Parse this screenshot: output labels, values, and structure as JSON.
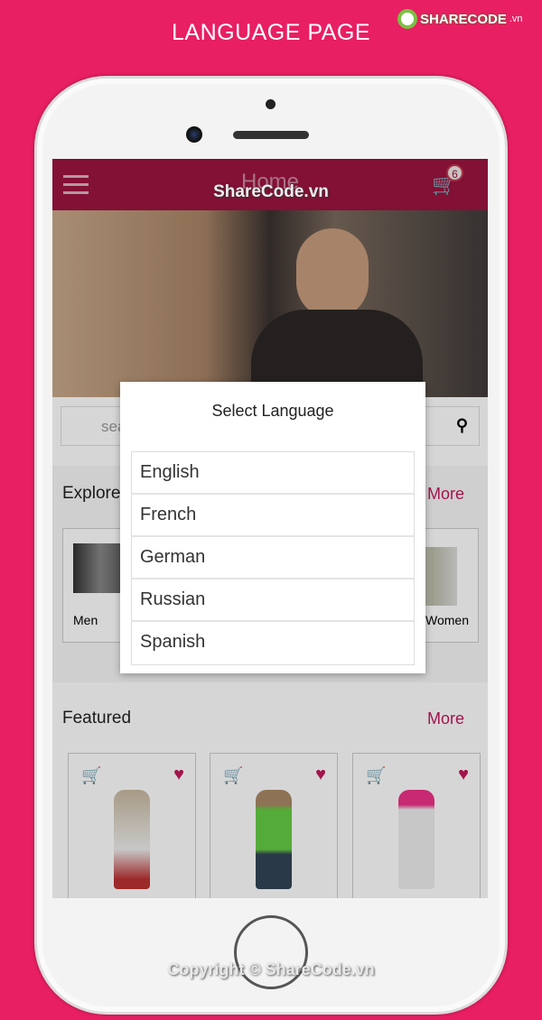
{
  "page_title": "LANGUAGE PAGE",
  "logo_text": "SHARECODE.vn",
  "app": {
    "header_title": "Home",
    "cart_count": "6",
    "search_placeholder": "search",
    "explore": {
      "title": "Explore",
      "more": "More",
      "items": [
        "Men",
        "Women"
      ]
    },
    "featured": {
      "title": "Featured",
      "more": "More"
    }
  },
  "dialog": {
    "title": "Select Language",
    "options": [
      "English",
      "French",
      "German",
      "Russian",
      "Spanish"
    ]
  },
  "watermark": "ShareCode.vn",
  "copyright": "Copyright © ShareCode.vn",
  "colors": {
    "background": "#e81f63",
    "header": "#9c1440",
    "accent": "#c2185b"
  }
}
